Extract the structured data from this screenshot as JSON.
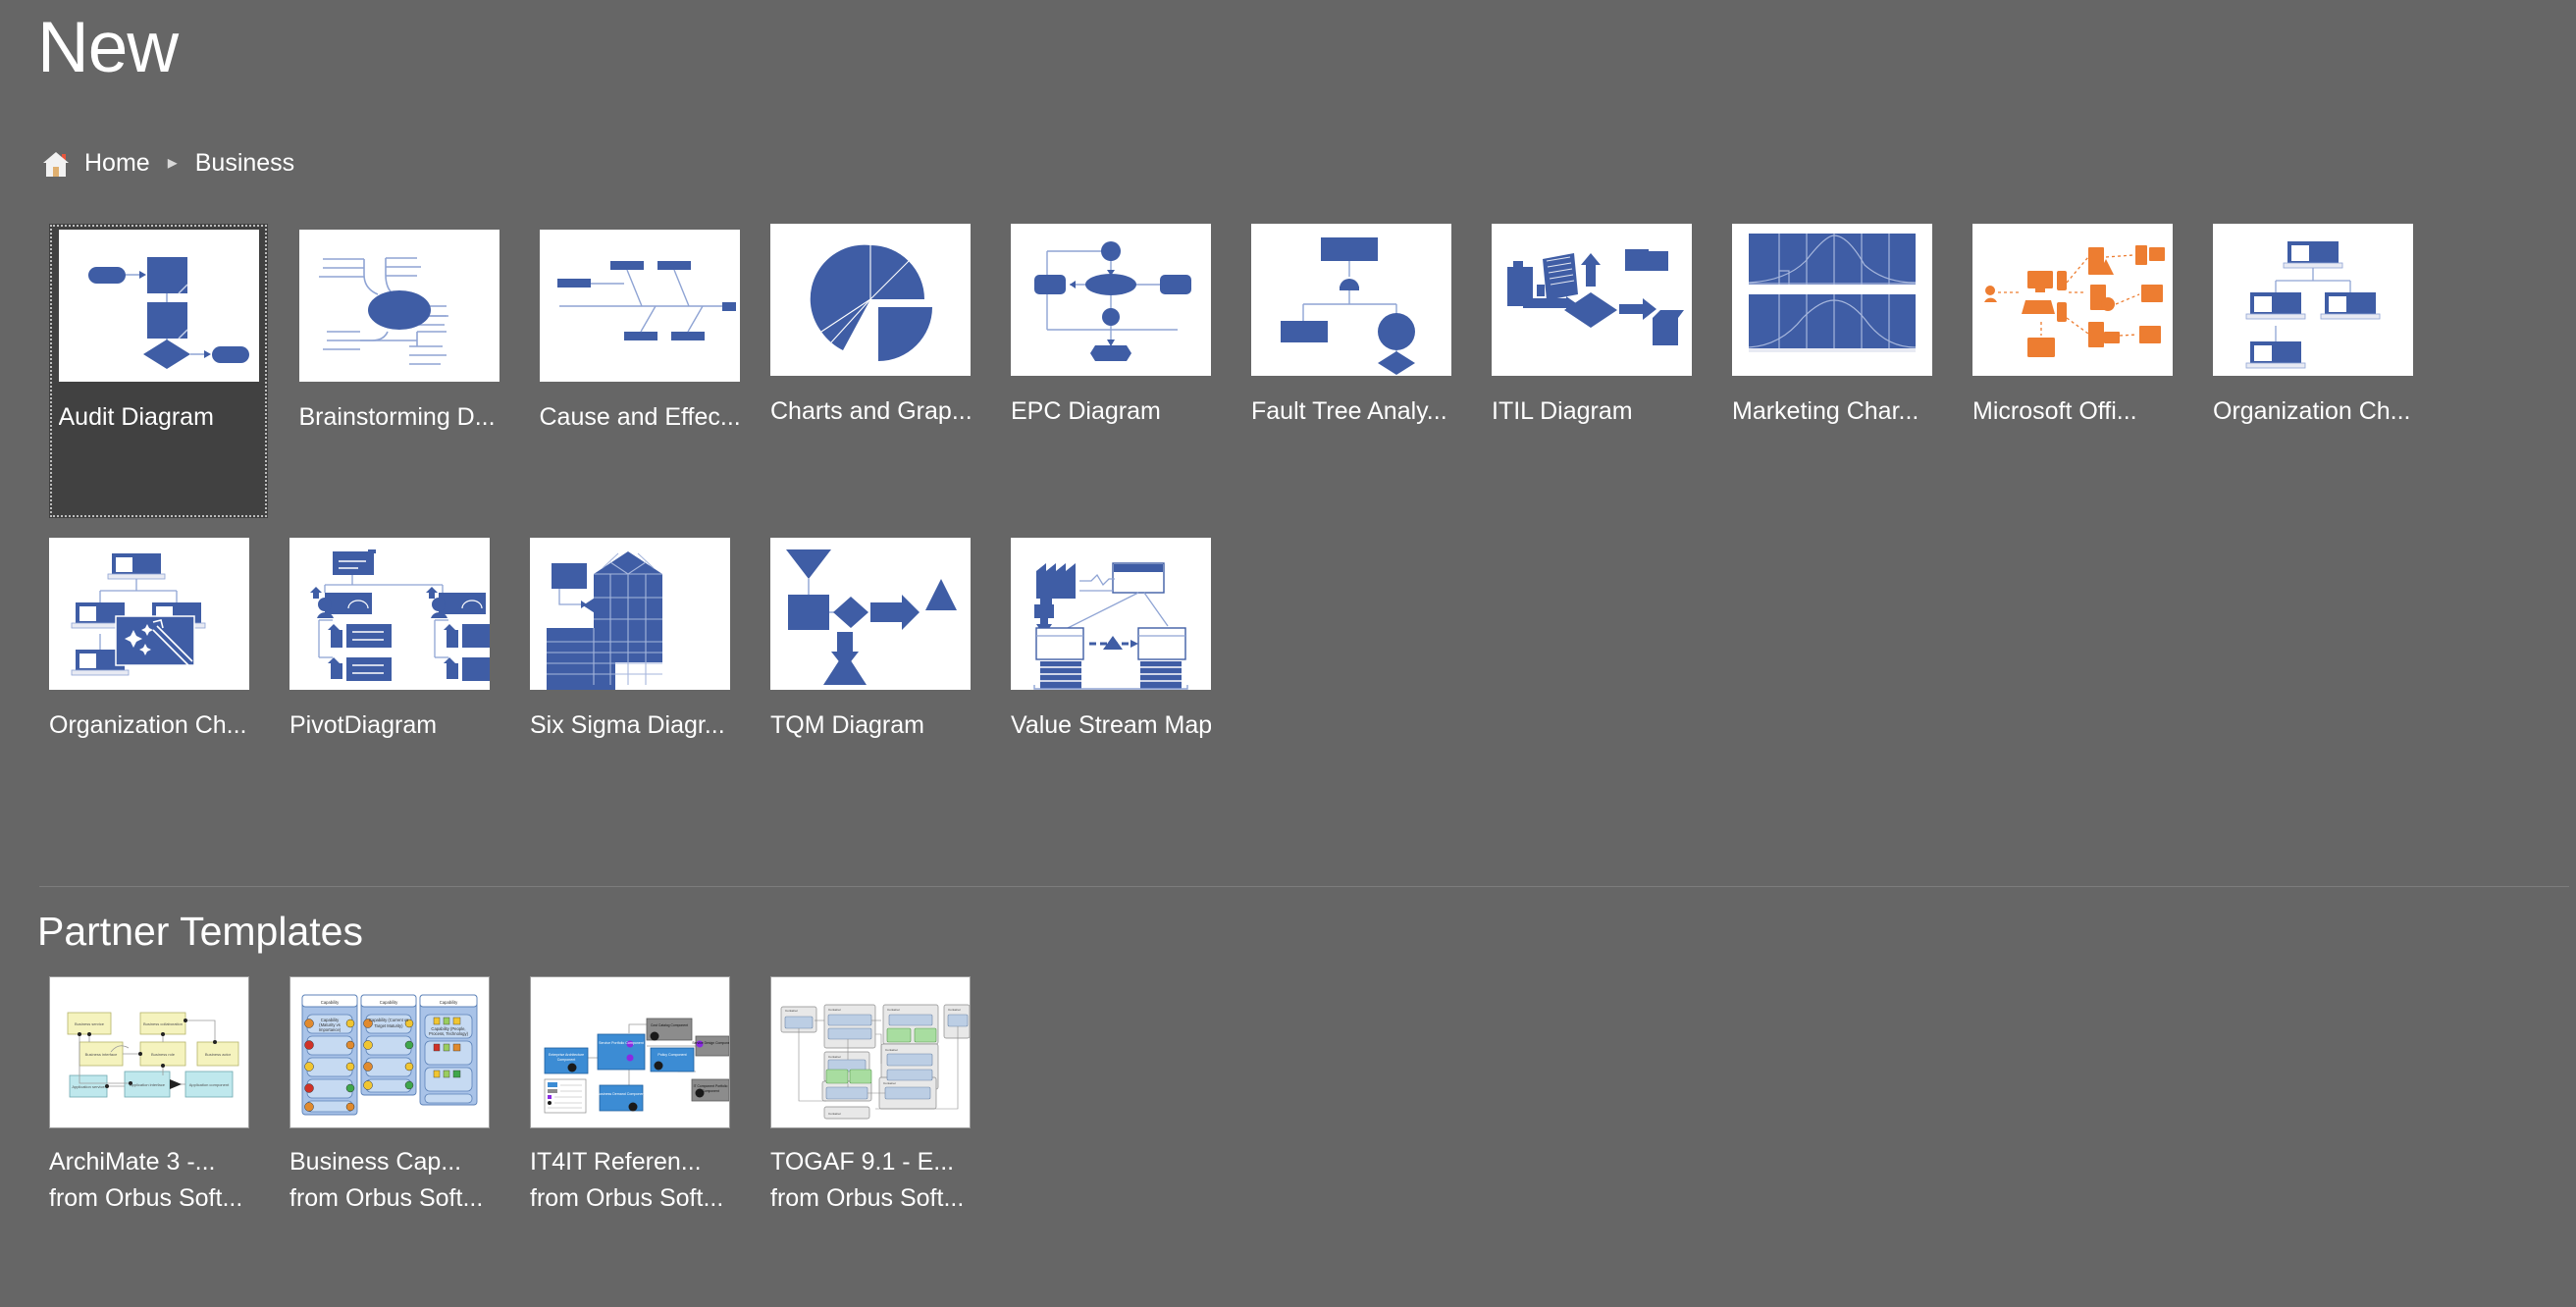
{
  "header": {
    "title": "New",
    "breadcrumb": {
      "home_icon": "home-icon",
      "home_label": "Home",
      "separator": "▸",
      "current": "Business"
    }
  },
  "templates": [
    {
      "label": "Audit Diagram",
      "icon": "audit-diagram-thumbnail",
      "selected": true
    },
    {
      "label": "Brainstorming D...",
      "icon": "brainstorming-diagram-thumbnail",
      "selected": false
    },
    {
      "label": "Cause and Effec...",
      "icon": "cause-and-effect-diagram-thumbnail",
      "selected": false
    },
    {
      "label": "Charts and Grap...",
      "icon": "charts-and-graphs-thumbnail",
      "selected": false
    },
    {
      "label": "EPC Diagram",
      "icon": "epc-diagram-thumbnail",
      "selected": false
    },
    {
      "label": "Fault Tree Analy...",
      "icon": "fault-tree-analysis-thumbnail",
      "selected": false
    },
    {
      "label": "ITIL Diagram",
      "icon": "itil-diagram-thumbnail",
      "selected": false
    },
    {
      "label": "Marketing Char...",
      "icon": "marketing-charts-thumbnail",
      "selected": false
    },
    {
      "label": "Microsoft Offi...",
      "icon": "microsoft-office-thumbnail",
      "selected": false
    },
    {
      "label": "Organization Ch...",
      "icon": "organization-chart-thumbnail",
      "selected": false
    },
    {
      "label": "Organization Ch...",
      "icon": "organization-chart-wizard-thumbnail",
      "selected": false
    },
    {
      "label": "PivotDiagram",
      "icon": "pivot-diagram-thumbnail",
      "selected": false
    },
    {
      "label": "Six Sigma Diagr...",
      "icon": "six-sigma-diagram-thumbnail",
      "selected": false
    },
    {
      "label": "TQM Diagram",
      "icon": "tqm-diagram-thumbnail",
      "selected": false
    },
    {
      "label": "Value Stream Map",
      "icon": "value-stream-map-thumbnail",
      "selected": false
    }
  ],
  "partner_section": {
    "title": "Partner Templates",
    "items": [
      {
        "label": "ArchiMate 3 -...",
        "publisher": "from Orbus Soft...",
        "icon": "archimate-thumbnail"
      },
      {
        "label": "Business Cap...",
        "publisher": "from Orbus Soft...",
        "icon": "business-capability-thumbnail"
      },
      {
        "label": "IT4IT Referen...",
        "publisher": "from Orbus Soft...",
        "icon": "it4it-reference-thumbnail"
      },
      {
        "label": "TOGAF 9.1 - E...",
        "publisher": "from Orbus Soft...",
        "icon": "togaf-thumbnail"
      }
    ]
  },
  "colors": {
    "background": "#666666",
    "selected_tile": "#414141",
    "accent_blue": "#4060AE",
    "shape_blue": "#3F5DA5",
    "connector_blue": "#8FA4D4",
    "office_orange": "#ED7D31",
    "text_white": "#FFFFFF",
    "divider": "#7D7D7D"
  }
}
